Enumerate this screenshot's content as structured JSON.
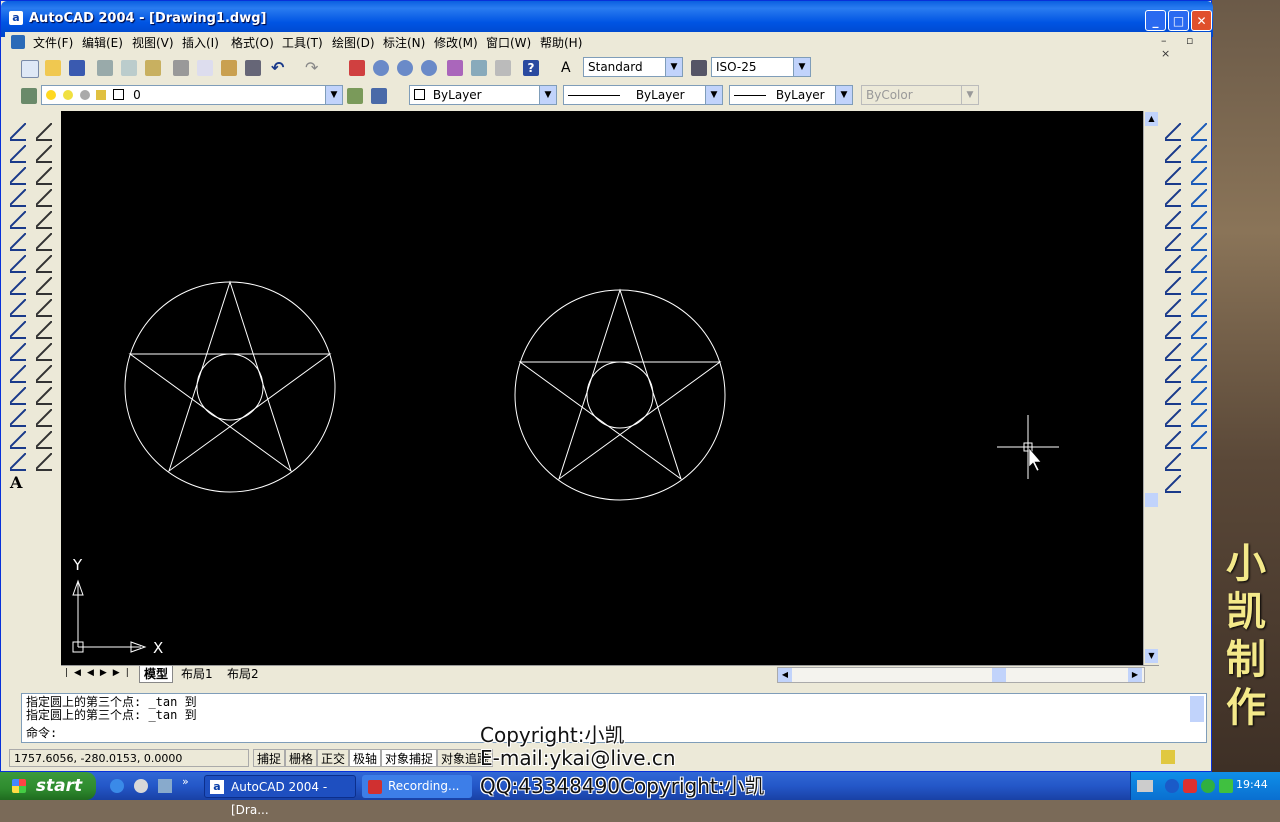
{
  "window": {
    "title": "AutoCAD 2004 - [Drawing1.dwg]",
    "app_icon": "a",
    "min_label": "_",
    "max_label": "□",
    "close_label": "✕"
  },
  "menu": {
    "items": [
      "文件(F)",
      "编辑(E)",
      "视图(V)",
      "插入(I)",
      "格式(O)",
      "工具(T)",
      "绘图(D)",
      "标注(N)",
      "修改(M)",
      "窗口(W)",
      "帮助(H)"
    ],
    "mdi": "– ▫ ×"
  },
  "toolbar": {
    "text_style": "Standard",
    "dim_style": "ISO-25",
    "layer": "0",
    "color": "ByLayer",
    "linetype": "ByLayer",
    "lineweight": "ByLayer",
    "plot_style": "ByColor"
  },
  "ucs": {
    "x_label": "X",
    "y_label": "Y"
  },
  "tabs": {
    "items": [
      "模型",
      "布局1",
      "布局2"
    ],
    "active": "模型"
  },
  "command": {
    "lines": [
      "指定圆上的第三个点: _tan 到",
      "指定圆上的第三个点: _tan 到"
    ],
    "prompt": "命令:"
  },
  "status": {
    "coords": "1757.6056, -280.0153, 0.0000",
    "toggles": [
      "捕捉",
      "栅格",
      "正交",
      "极轴",
      "对象捕捉",
      "对象追踪"
    ]
  },
  "taskbar": {
    "start": "start",
    "tasks": [
      "AutoCAD 2004 - [Dra...",
      "Recording..."
    ],
    "clock": "19:44"
  },
  "watermark": {
    "copyright": "Copyright:小凯",
    "email": "E-mail:ykai@live.cn",
    "qq": "QQ:43348490Copyright:小凯"
  },
  "brand": {
    "vertical_text": "小凯制作"
  },
  "colors": {
    "titlebar": "#0054e3",
    "canvas": "#000000",
    "lines": "#ffffff",
    "taskbar": "#2457c8",
    "start": "#2e8b2e",
    "brand_text": "#f4e98a"
  }
}
